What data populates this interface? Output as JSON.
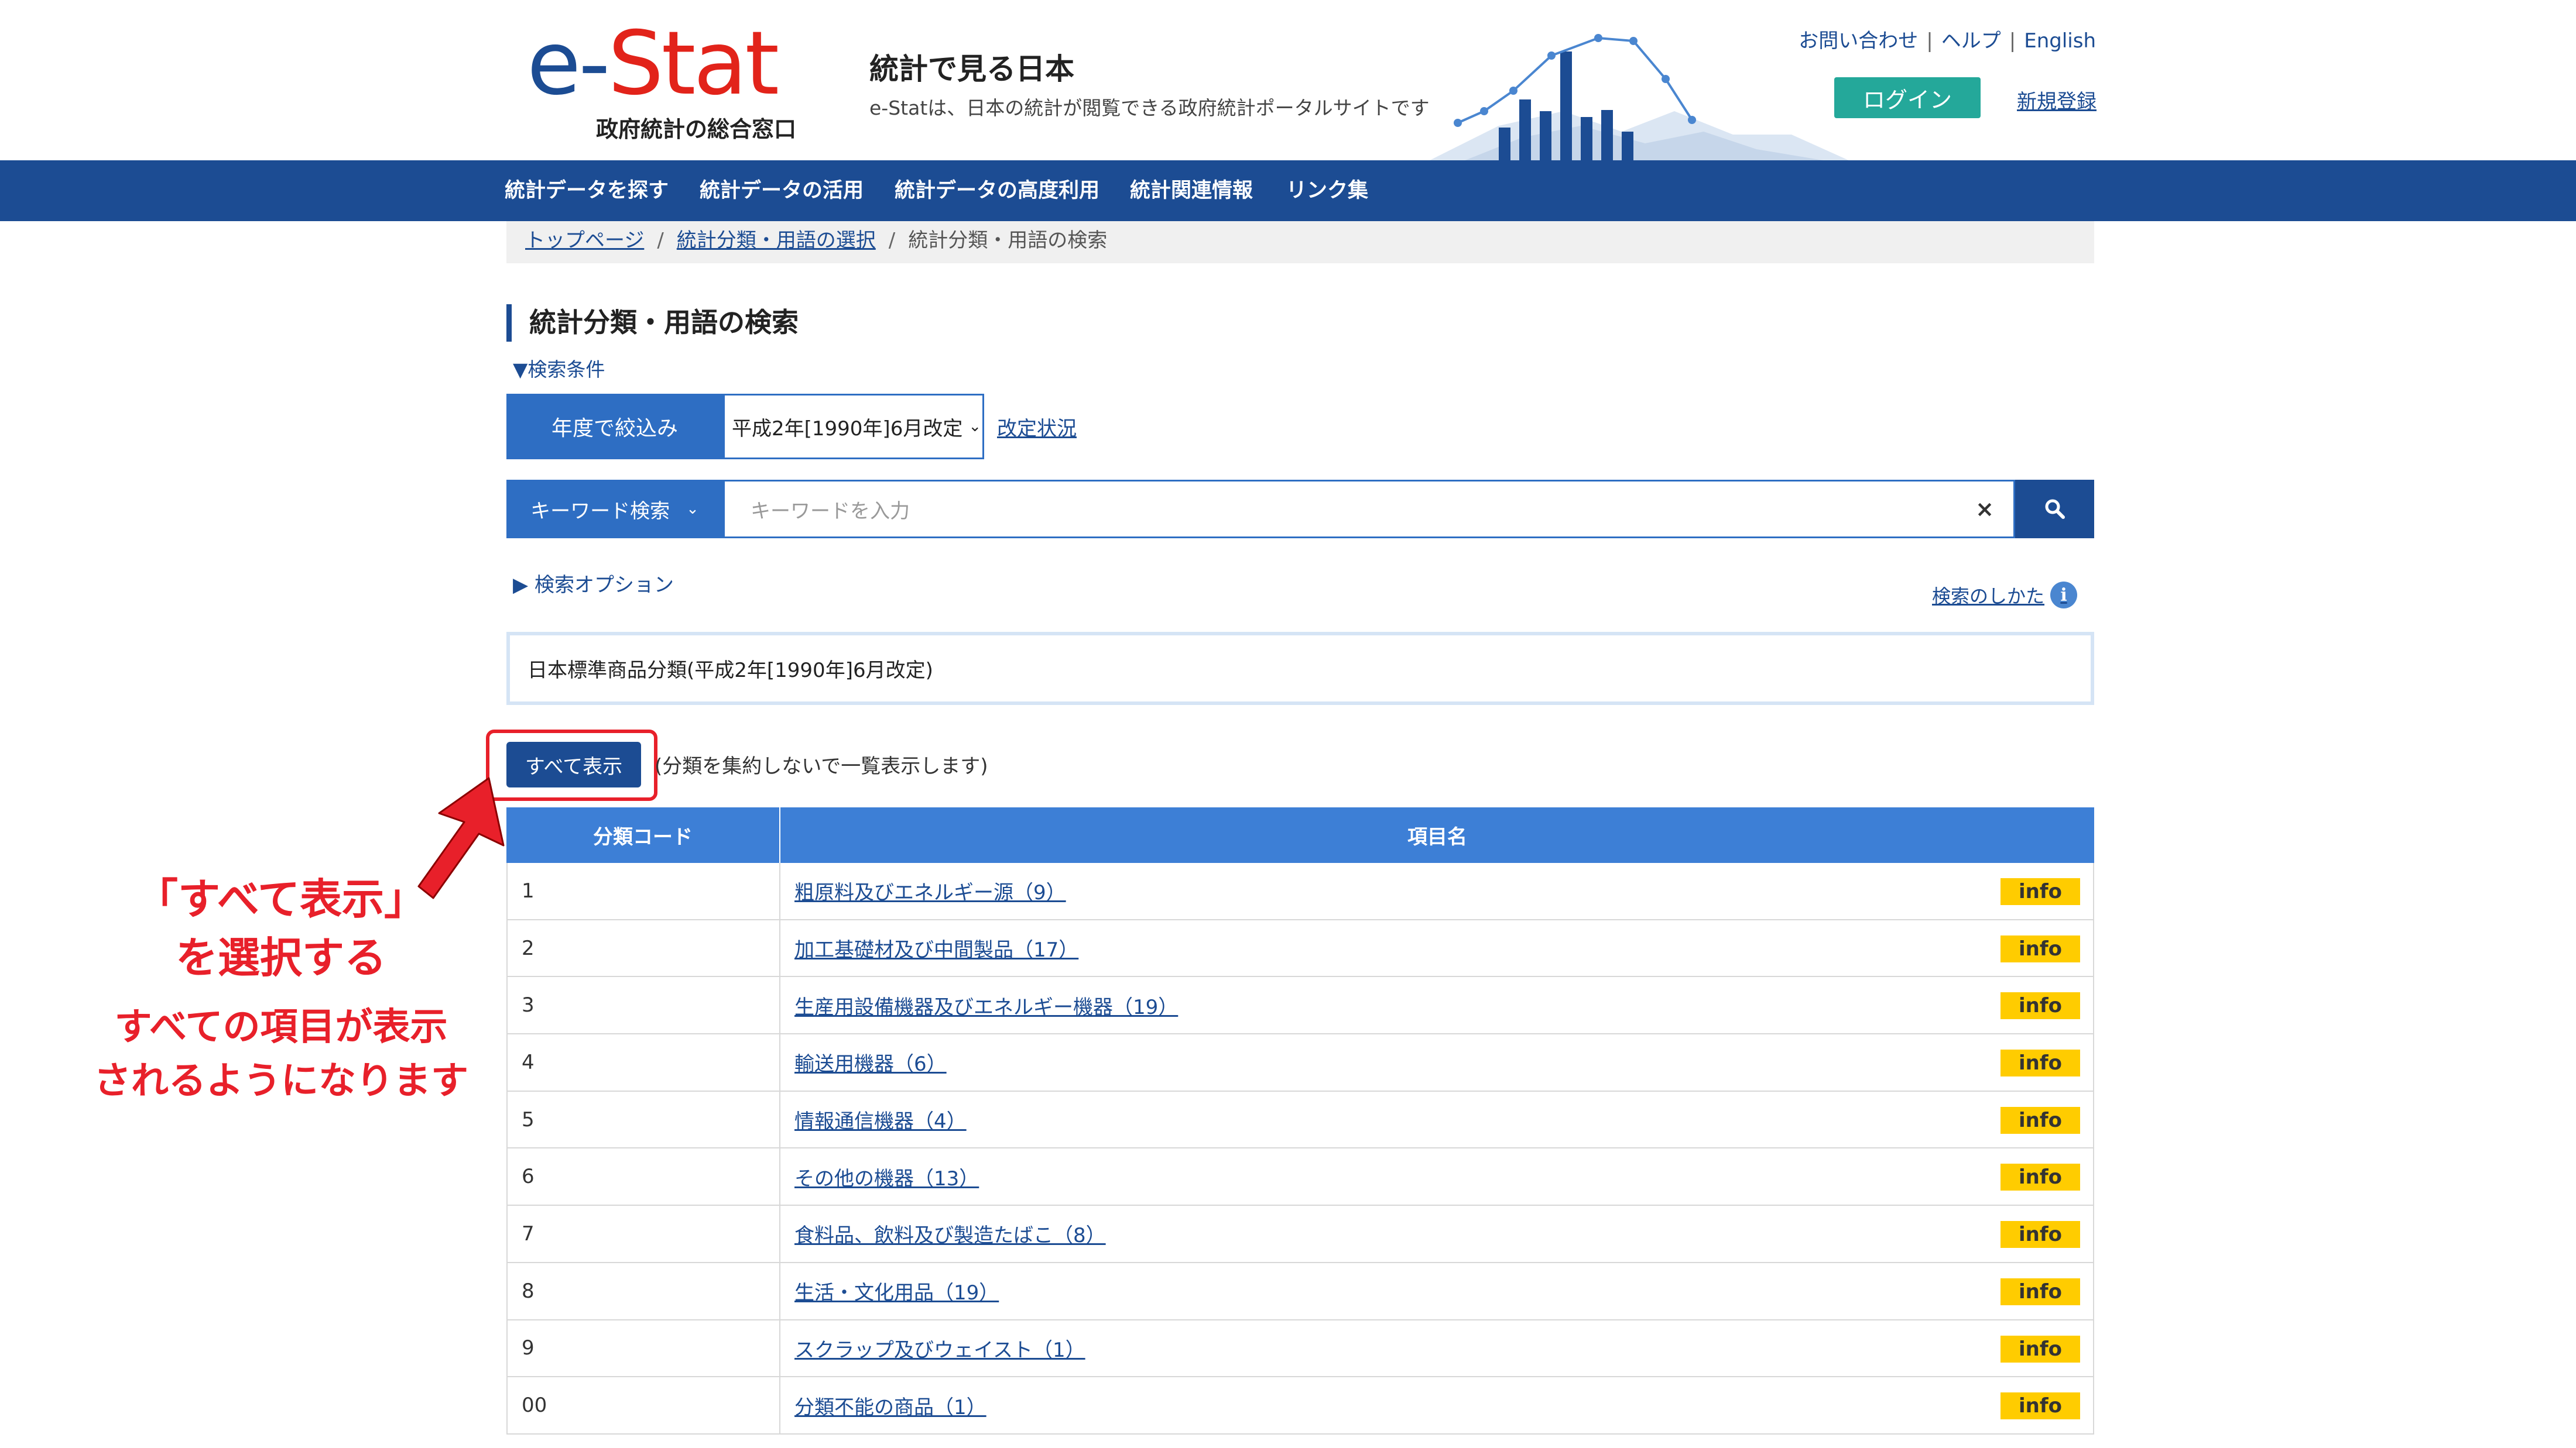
{
  "header": {
    "logo_e": "e-",
    "logo_stat": "Stat",
    "logo_sub": "政府統計の総合窓口",
    "tagline_main": "統計で見る日本",
    "tagline_sub": "e-Statは、日本の統計が閲覧できる政府統計ポータルサイトです",
    "links": [
      "お問い合わせ",
      "ヘルプ",
      "English"
    ],
    "login_label": "ログイン",
    "register_label": "新規登録"
  },
  "nav": {
    "items": [
      "統計データを探す",
      "統計データの活用",
      "統計データの高度利用",
      "統計関連情報",
      "リンク集"
    ]
  },
  "breadcrumb": {
    "items": [
      "トップページ",
      "統計分類・用語の選択"
    ],
    "current": "統計分類・用語の検索"
  },
  "page": {
    "title": "統計分類・用語の検索",
    "conditions_toggle": "検索条件",
    "year_filter_label": "年度で絞込み",
    "year_selected": "平成2年[1990年]6月改定",
    "revision_link": "改定状況",
    "keyword_type": "キーワード検索",
    "keyword_placeholder": "キーワードを入力",
    "clear_symbol": "×",
    "search_options": "検索オプション",
    "how_to_search": "検索のしかた",
    "classification_name": "日本標準商品分類(平成2年[1990年]6月改定)",
    "show_all_label": "すべて表示",
    "show_all_note": "(分類を集約しないで一覧表示します)"
  },
  "annotation": {
    "line1": "「すべて表示」",
    "line2": "を選択する",
    "line3": "すべての項目が表示",
    "line4": "されるようになります",
    "color": "#e8202a"
  },
  "table": {
    "headers": [
      "分類コード",
      "項目名"
    ],
    "info_label": "info",
    "rows": [
      {
        "code": "1",
        "name": "粗原料及びエネルギー源（9）"
      },
      {
        "code": "2",
        "name": "加工基礎材及び中間製品（17）"
      },
      {
        "code": "3",
        "name": "生産用設備機器及びエネルギー機器（19）"
      },
      {
        "code": "4",
        "name": "輸送用機器（6）"
      },
      {
        "code": "5",
        "name": "情報通信機器（4）"
      },
      {
        "code": "6",
        "name": "その他の機器（13）"
      },
      {
        "code": "7",
        "name": "食料品、飲料及び製造たばこ（8）"
      },
      {
        "code": "8",
        "name": "生活・文化用品（19）"
      },
      {
        "code": "9",
        "name": "スクラップ及びウェイスト（1）"
      },
      {
        "code": "00",
        "name": "分類不能の商品（1）"
      }
    ]
  },
  "colors": {
    "brand_blue": "#1c4c93",
    "accent_blue": "#2e6ec3",
    "table_header": "#3d7fd6",
    "login_green": "#24a89a",
    "info_yellow": "#ffcc00",
    "logo_red": "#e2231a"
  }
}
